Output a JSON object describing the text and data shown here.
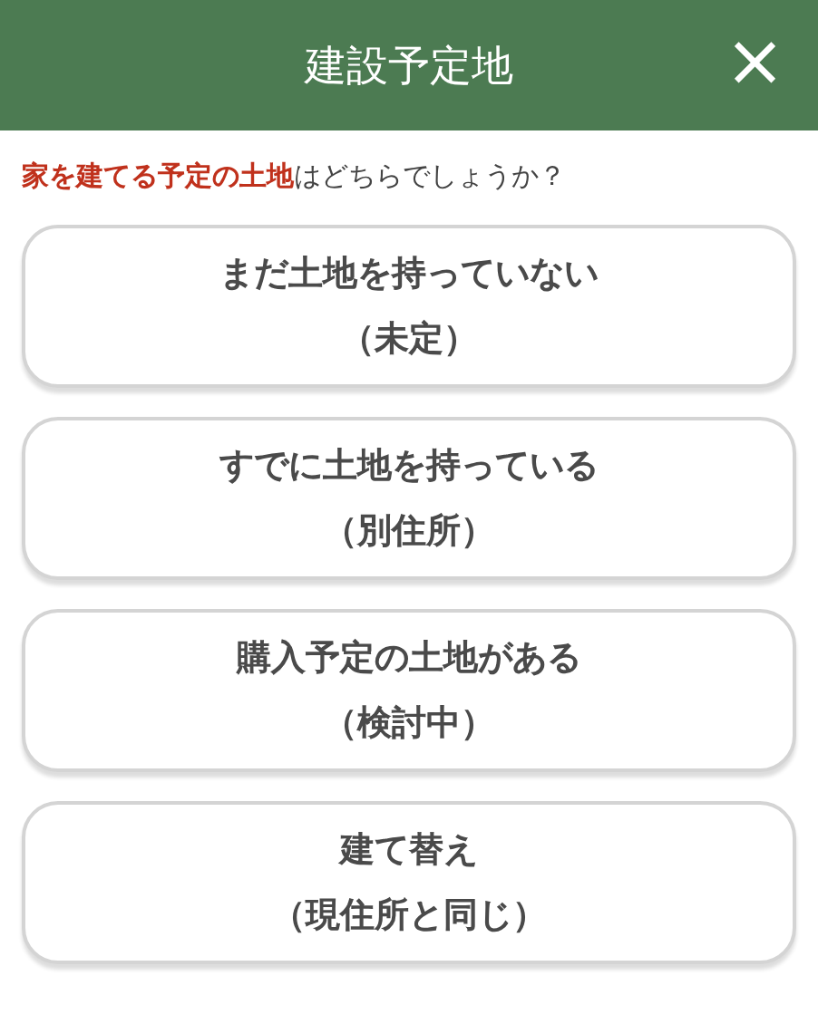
{
  "header": {
    "title": "建設予定地",
    "close": "×"
  },
  "question": "**家を建てる予定の土地**はどちらでしょうか？",
  "options": [
    {
      "line1": "まだ土地を持っていない",
      "line2": "（未定）"
    },
    {
      "line1": "すでに土地を持っている",
      "line2": "（別住所）"
    },
    {
      "line1": "購入予定の土地がある",
      "line2": "（検討中）"
    },
    {
      "line1": "建て替え",
      "line2": "（現住所と同じ）"
    }
  ]
}
